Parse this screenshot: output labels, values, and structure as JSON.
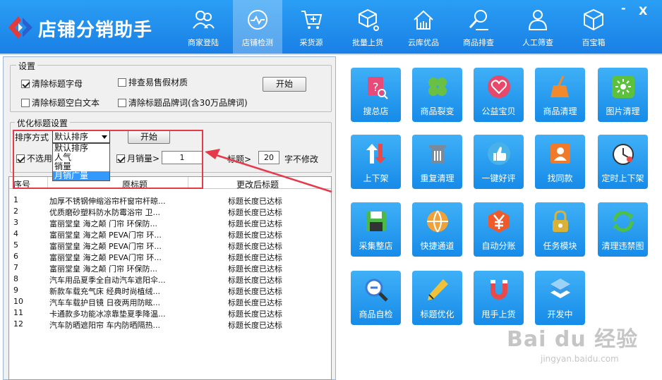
{
  "app": {
    "title": "店铺分销助手"
  },
  "nav": [
    {
      "label": "商家登陆",
      "icon": "users-icon"
    },
    {
      "label": "店铺检测",
      "icon": "monitor-check-icon",
      "active": true
    },
    {
      "label": "采货源",
      "icon": "cart-plus-icon"
    },
    {
      "label": "批量上货",
      "icon": "cube-network-icon"
    },
    {
      "label": "云库优品",
      "icon": "cloud-house-icon"
    },
    {
      "label": "商品排查",
      "icon": "search-person-icon"
    },
    {
      "label": "人工筛查",
      "icon": "person-icon"
    },
    {
      "label": "百宝箱",
      "icon": "box-icon"
    }
  ],
  "window": {
    "minimize": "-",
    "close": "X"
  },
  "settings": {
    "legend": "设置",
    "remove_title_chars": "清除标题字母",
    "remove_title_spaces": "清除标题空白文本",
    "check_fake_material": "排查易售假材质",
    "remove_brand_words": "清除标题品牌词(含30万品牌词)",
    "start": "开始"
  },
  "optimize": {
    "legend": "优化标题设置",
    "sort_label": "排序方式",
    "sort_selected": "默认排序",
    "sort_options": [
      "默认排序",
      "人气",
      "销量",
      "月销广量"
    ],
    "start": "开始",
    "unused_prefix": "不选用",
    "monthly_sales": "月销量>",
    "monthly_value": "1",
    "title_gt": "标题>",
    "title_value": "20",
    "no_modify": "字不修改"
  },
  "table": {
    "headers": [
      "序号",
      "原标题",
      "更改后标题"
    ],
    "rows": [
      {
        "no": "1",
        "orig": "加厚不锈钢伸缩浴帘杆窗帘杆晾...",
        "new": "标题长度已达标"
      },
      {
        "no": "2",
        "orig": "优质磨砂塑料防水防霉浴帘 卫...",
        "new": "标题长度已达标"
      },
      {
        "no": "3",
        "orig": "富丽堂皇 海之颠 门帘 环保防...",
        "new": "标题长度已达标"
      },
      {
        "no": "4",
        "orig": "富丽堂皇 海之颠 PEVA门帘 环...",
        "new": "标题长度已达标"
      },
      {
        "no": "5",
        "orig": "富丽堂皇 海之颠 PEVA门帘 环...",
        "new": "标题长度已达标"
      },
      {
        "no": "6",
        "orig": "富丽堂皇 海之颠 PEVA门帘 环...",
        "new": "标题长度已达标"
      },
      {
        "no": "7",
        "orig": "富丽堂皇 海之颠 门帘 环保防...",
        "new": "标题长度已达标"
      },
      {
        "no": "8",
        "orig": "汽车用品夏季全自动汽车遮阳伞...",
        "new": "标题长度已达标"
      },
      {
        "no": "9",
        "orig": "新款车载充气床 经典时尚植绒...",
        "new": "标题长度已达标"
      },
      {
        "no": "10",
        "orig": "汽车车载护目镜 日夜两用防眩...",
        "new": "标题长度已达标"
      },
      {
        "no": "11",
        "orig": "卡通款多功能冰凉靠垫夏季降温...",
        "new": "标题长度已达标"
      },
      {
        "no": "12",
        "orig": "汽车防晒遮阳帘 车内防晒隔热...",
        "new": "标题长度已达标"
      }
    ]
  },
  "tiles": [
    {
      "label": "搜总店",
      "icon": "search-store-icon",
      "accent": "#e84a7a"
    },
    {
      "label": "商品裂变",
      "icon": "clover-icon",
      "accent": "#6ac043"
    },
    {
      "label": "公益宝贝",
      "icon": "heart-icon",
      "accent": "#e8486a"
    },
    {
      "label": "商品清理",
      "icon": "broom-icon",
      "accent": "#f08a2c"
    },
    {
      "label": "图片清理",
      "icon": "sparkle-icon",
      "accent": "#5cc23e"
    },
    {
      "label": "上下架",
      "icon": "up-down-arrows-icon",
      "accent": "#e84a4a"
    },
    {
      "label": "重复清理",
      "icon": "trash-icon",
      "accent": "#7a8a9a"
    },
    {
      "label": "一键好评",
      "icon": "thumbs-up-icon",
      "accent": "#4ab0e8"
    },
    {
      "label": "找同款",
      "icon": "find-same-icon",
      "accent": "#f07a2a"
    },
    {
      "label": "定时上下架",
      "icon": "clock-icon",
      "accent": "#f0f0f0"
    },
    {
      "label": "采集整店",
      "icon": "save-disk-icon",
      "accent": "#4cb848"
    },
    {
      "label": "快捷通道",
      "icon": "globe-icon",
      "accent": "#f0a23a"
    },
    {
      "label": "自动分账",
      "icon": "yen-icon",
      "accent": "#f05a2a"
    },
    {
      "label": "任务模块",
      "icon": "lock-icon",
      "accent": "#d9b23a"
    },
    {
      "label": "清理违禁图",
      "icon": "refresh-icon",
      "accent": "#4cc048"
    },
    {
      "label": "商品自检",
      "icon": "magnifier-icon",
      "accent": "#3a7ad8"
    },
    {
      "label": "标题优化",
      "icon": "pencil-icon",
      "accent": "#f0c23a"
    },
    {
      "label": "甩手上货",
      "icon": "magnet-icon",
      "accent": "#e84a4a"
    },
    {
      "label": "开发中",
      "icon": "layers-icon",
      "accent": "#3a9ae8"
    }
  ],
  "watermark": {
    "brand": "Bai du 经验",
    "url": "jingyan.baidu.com"
  }
}
